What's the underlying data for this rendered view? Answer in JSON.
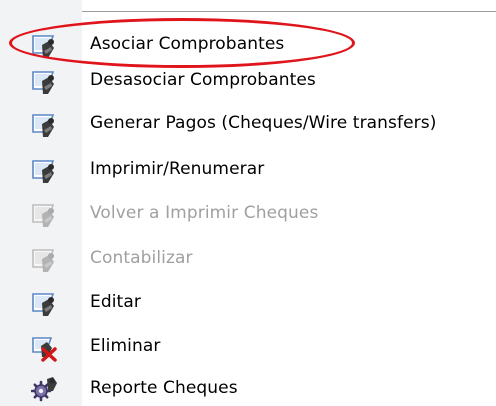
{
  "menu": {
    "items": [
      {
        "label": "Asociar Comprobantes",
        "icon": "user-edit-icon",
        "enabled": true
      },
      {
        "label": "Desasociar Comprobantes",
        "icon": "user-edit-icon",
        "enabled": true
      },
      {
        "label": "Generar Pagos (Cheques/Wire transfers)",
        "icon": "user-edit-icon",
        "enabled": true
      },
      {
        "label": "Imprimir/Renumerar",
        "icon": "user-edit-icon",
        "enabled": true
      },
      {
        "label": "Volver a Imprimir Cheques",
        "icon": "user-edit-icon",
        "enabled": false
      },
      {
        "label": "Contabilizar",
        "icon": "user-edit-icon",
        "enabled": false
      },
      {
        "label": "Editar",
        "icon": "user-edit-icon",
        "enabled": true
      },
      {
        "label": "Eliminar",
        "icon": "delete-user-icon",
        "enabled": true
      },
      {
        "label": "Reporte Cheques",
        "icon": "report-gear-icon",
        "enabled": true
      }
    ]
  },
  "annotation": {
    "color": "#e0141b"
  }
}
